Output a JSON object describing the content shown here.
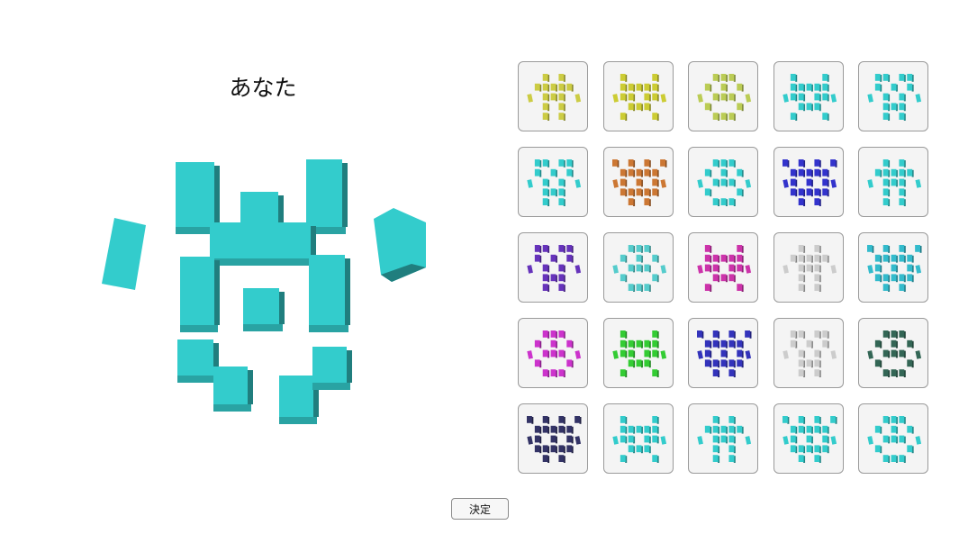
{
  "title": "あなた",
  "confirm_label": "決定",
  "selected_color": "#33cccc",
  "characters": [
    {
      "color": "#cccc44",
      "variant": 0
    },
    {
      "color": "#cccc33",
      "variant": 1
    },
    {
      "color": "#bbcc55",
      "variant": 2
    },
    {
      "color": "#33cccc",
      "variant": 1
    },
    {
      "color": "#33cccc",
      "variant": 3
    },
    {
      "color": "#33cccc",
      "variant": 3
    },
    {
      "color": "#cc7733",
      "variant": 4
    },
    {
      "color": "#33cccc",
      "variant": 2
    },
    {
      "color": "#3333cc",
      "variant": 4
    },
    {
      "color": "#33cccc",
      "variant": 0
    },
    {
      "color": "#6633bb",
      "variant": 3
    },
    {
      "color": "#55cccc",
      "variant": 2
    },
    {
      "color": "#cc33aa",
      "variant": 1
    },
    {
      "color": "#cccccc",
      "variant": 0
    },
    {
      "color": "#33bbcc",
      "variant": 4
    },
    {
      "color": "#cc33cc",
      "variant": 2
    },
    {
      "color": "#33cc33",
      "variant": 1
    },
    {
      "color": "#3333bb",
      "variant": 4
    },
    {
      "color": "#cccccc",
      "variant": 3
    },
    {
      "color": "#336655",
      "variant": 2
    },
    {
      "color": "#333366",
      "variant": 4
    },
    {
      "color": "#33cccc",
      "variant": 1
    },
    {
      "color": "#33cccc",
      "variant": 0
    },
    {
      "color": "#33cccc",
      "variant": 4
    },
    {
      "color": "#33cccc",
      "variant": 2
    }
  ]
}
